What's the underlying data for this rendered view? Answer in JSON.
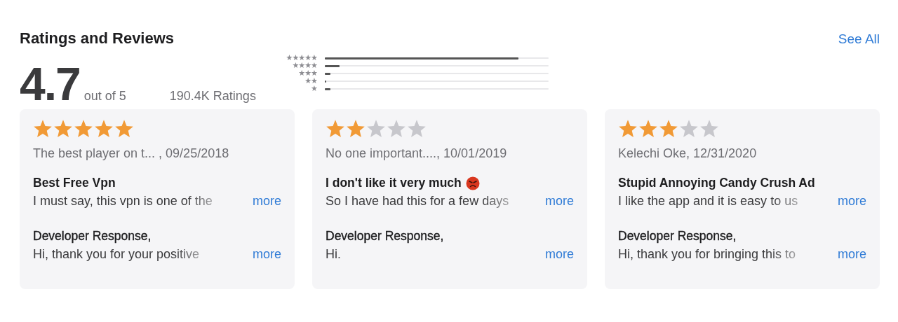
{
  "section": {
    "title": "Ratings and Reviews",
    "see_all": "See All"
  },
  "summary": {
    "score": "4.7",
    "out_of": "out of 5",
    "count": "190.4K Ratings"
  },
  "histogram": [
    {
      "label": "★★★★★",
      "level": 0.865
    },
    {
      "label": "★★★★",
      "level": 0.066
    },
    {
      "label": "★★★",
      "level": 0.025
    },
    {
      "label": "★★",
      "level": 0.006
    },
    {
      "label": "★",
      "level": 0.025
    }
  ],
  "reviews": [
    {
      "stars": 5,
      "byline": "The best player on t...  , 09/25/2018",
      "title": "Best Free Vpn",
      "title_icon": false,
      "body": "I must say, this vpn is one of the",
      "more": "more",
      "response_label": "Developer Response,",
      "response": "Hi, thank you for your positive",
      "response_more": "more"
    },
    {
      "stars": 2,
      "byline": "No one important...., 10/01/2019",
      "title": "I don't like it very much",
      "title_icon": true,
      "body": "So I have had this for a few days",
      "more": "more",
      "response_label": "Developer Response,",
      "response": "Hi.",
      "response_more": "more"
    },
    {
      "stars": 3,
      "byline": "Kelechi Oke, 12/31/2020",
      "title": "Stupid Annoying Candy Crush Ad",
      "title_icon": false,
      "body": "I like the app and it is easy to us",
      "more": "more",
      "response_label": "Developer Response,",
      "response": "Hi, thank you for bringing this to",
      "response_more": "more"
    }
  ]
}
